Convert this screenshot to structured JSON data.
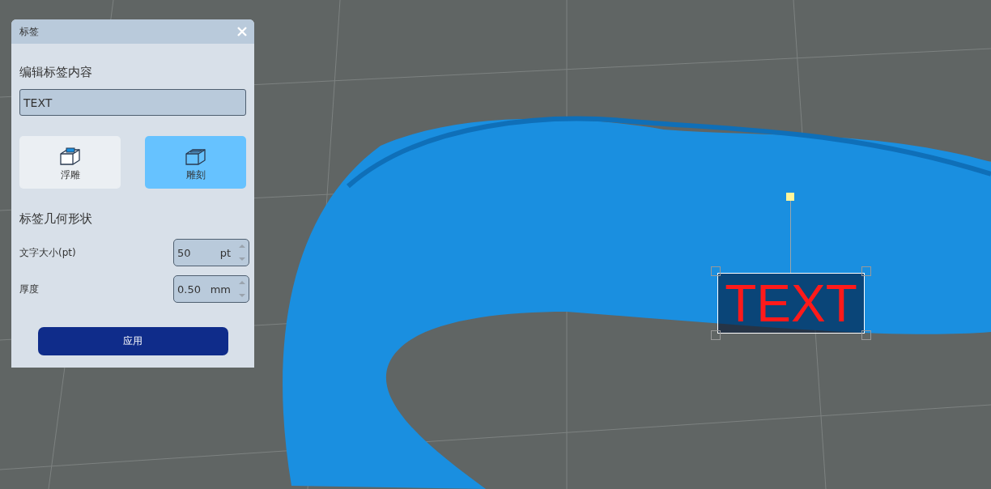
{
  "viewport": {
    "label_preview": {
      "text": "TEXT"
    }
  },
  "panel": {
    "title": "标签",
    "content_heading": "编辑标签内容",
    "text_field": {
      "value": "TEXT"
    },
    "modes": [
      {
        "label": "浮雕",
        "kind": "emboss",
        "selected": false
      },
      {
        "label": "雕刻",
        "kind": "engrave",
        "selected": true
      }
    ],
    "geometry_heading": "标签几何形状",
    "fields": [
      {
        "label": "文字大小(pt)",
        "value": "50",
        "unit": "pt"
      },
      {
        "label": "厚度",
        "value": "0.50",
        "unit": "mm"
      }
    ],
    "apply_button": "应用"
  }
}
